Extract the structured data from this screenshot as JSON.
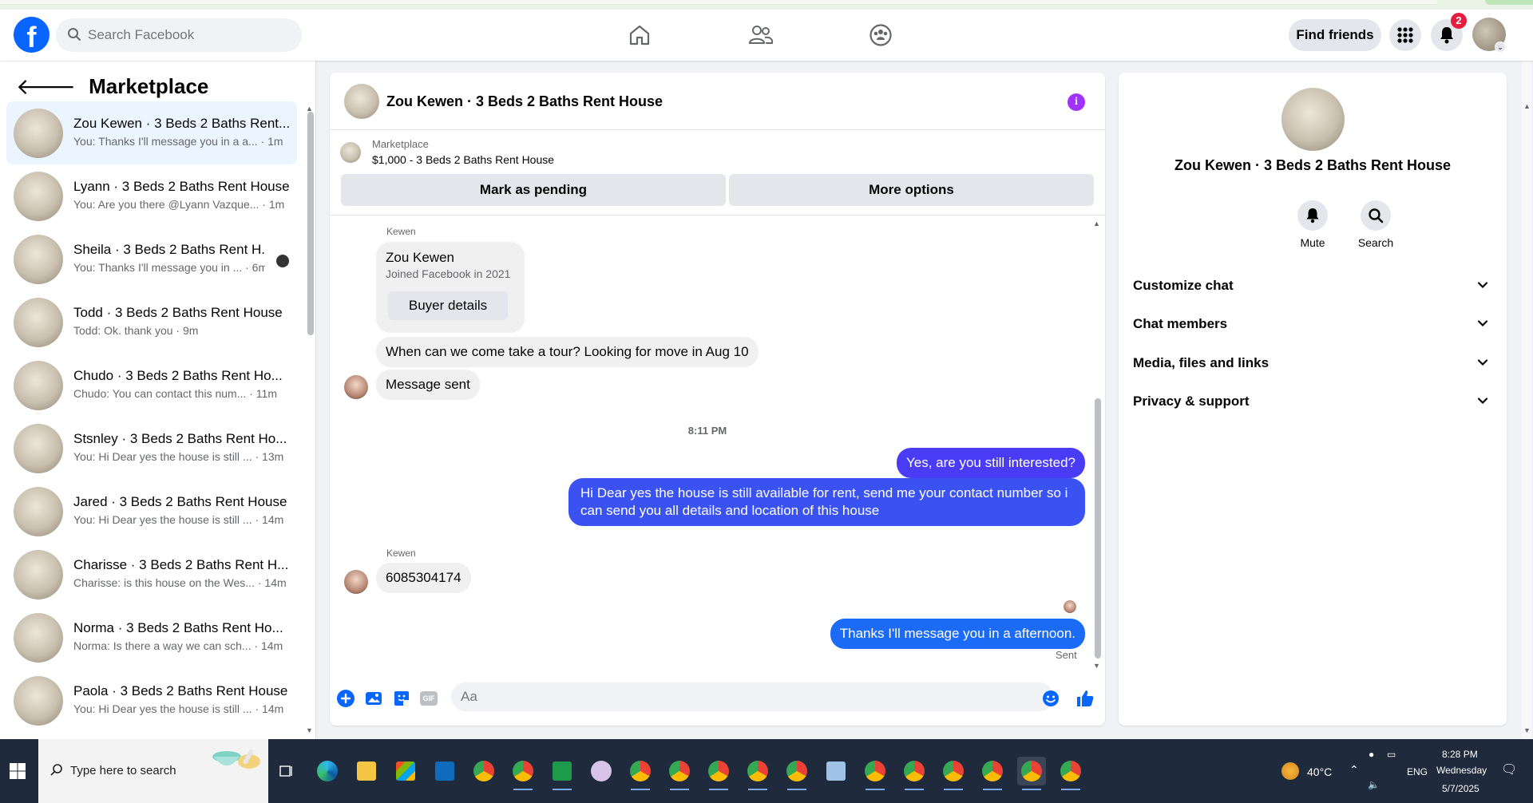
{
  "header": {
    "logo": "f",
    "search_placeholder": "Search Facebook",
    "find_friends_label": "Find friends",
    "notification_count": "2"
  },
  "sidebar": {
    "title": "Marketplace",
    "conversations": [
      {
        "name": "Zou Kewen · 3 Beds 2 Baths Rent...",
        "preview": "You: Thanks I'll message you in a a... · 1m",
        "active": true
      },
      {
        "name": "Lyann · 3 Beds 2 Baths Rent House",
        "preview": "You: Are you there @Lyann Vazque... · 1m"
      },
      {
        "name": "Sheila · 3 Beds 2 Baths Rent H...",
        "preview": "You: Thanks I'll message you in ... · 6m"
      },
      {
        "name": "Todd · 3 Beds 2 Baths Rent House",
        "preview": "Todd: Ok. thank you · 9m"
      },
      {
        "name": "Chudo · 3 Beds 2 Baths Rent Ho...",
        "preview": "Chudo: You can contact this num... · 11m"
      },
      {
        "name": "Stsnley · 3 Beds 2 Baths Rent Ho...",
        "preview": "You: Hi Dear yes the house is still ... · 13m"
      },
      {
        "name": "Jared · 3 Beds 2 Baths Rent House",
        "preview": "You: Hi Dear yes the house is still ... · 14m"
      },
      {
        "name": "Charisse · 3 Beds 2 Baths Rent H...",
        "preview": "Charisse: is this house on the Wes... · 14m"
      },
      {
        "name": "Norma · 3 Beds 2 Baths Rent Ho...",
        "preview": "Norma: Is there a way we can sch... · 14m"
      },
      {
        "name": "Paola · 3 Beds 2 Baths Rent House",
        "preview": "You: Hi Dear yes the house is still ... · 14m"
      }
    ]
  },
  "chat": {
    "title": "Zou Kewen · 3 Beds 2 Baths Rent House",
    "listing_source": "Marketplace",
    "listing_price_title": "$1,000 - 3 Beds 2 Baths Rent House",
    "mark_pending_label": "Mark as pending",
    "more_options_label": "More options",
    "sender_short": "Kewen",
    "buyer_name": "Zou Kewen",
    "buyer_joined": "Joined Facebook in 2021",
    "buyer_details_label": "Buyer details",
    "msg_in_1": "When can we come take a tour? Looking for move in Aug 10",
    "msg_in_2": "Message sent",
    "time_separator": "8:11 PM",
    "msg_out_1": "Yes, are you still interested?",
    "msg_out_2": "Hi Dear yes the house is still available for rent, send me your contact number so i can send you all details and location of this house",
    "sender_short_2": "Kewen",
    "msg_in_3": "6085304174",
    "msg_out_3": "Thanks I'll message you in a afternoon.",
    "sent_status": "Sent",
    "composer_placeholder": "Aa",
    "gif_label": "GIF"
  },
  "right_panel": {
    "name": "Zou Kewen · 3 Beds 2 Baths Rent House",
    "mute_label": "Mute",
    "search_label": "Search",
    "sections": [
      "Customize chat",
      "Chat members",
      "Media, files and links",
      "Privacy & support"
    ]
  },
  "taskbar": {
    "search_placeholder": "Type here to search",
    "weather": "40°C",
    "lang": "ENG",
    "time": "8:28 PM",
    "day": "Wednesday",
    "date": "5/7/2025"
  },
  "colors": {
    "brand": "#0866ff",
    "outgoing_bubble": "#4a3bf5",
    "outgoing_bubble_last": "#1b6bf7",
    "info_icon": "#a033ff"
  }
}
